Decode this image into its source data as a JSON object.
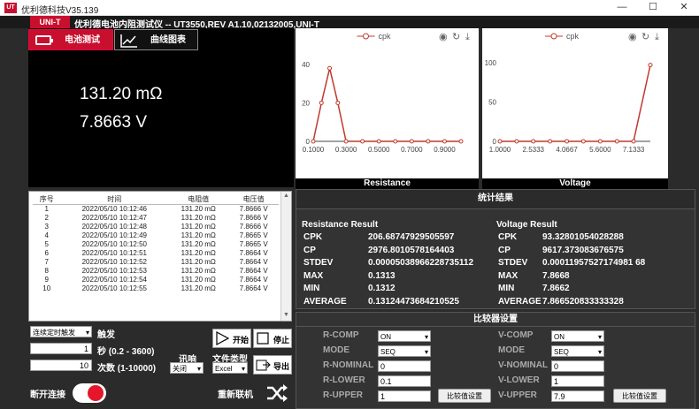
{
  "window": {
    "title": "优利德科技V35.139",
    "min": "—",
    "max": "☐",
    "close": "✕"
  },
  "header": {
    "logo": "UNI-T",
    "subtitle": "优利德电池内阻测试仪 -- UT3550,REV A1.10,02132005,UNI-T"
  },
  "tabs": [
    {
      "label": "电池测试"
    },
    {
      "label": "曲线图表"
    }
  ],
  "reading": {
    "resistance": "131.20 mΩ",
    "voltage": "7.8663 V"
  },
  "table": {
    "headers": [
      "序号",
      "时间",
      "电阻值",
      "电压值"
    ],
    "rows": [
      [
        "1",
        "2022/05/10 10:12:46",
        "131.20 mΩ",
        "7.8666 V"
      ],
      [
        "2",
        "2022/05/10 10:12:47",
        "131.20 mΩ",
        "7.8666 V"
      ],
      [
        "3",
        "2022/05/10 10:12:48",
        "131.20 mΩ",
        "7.8666 V"
      ],
      [
        "4",
        "2022/05/10 10:12:49",
        "131.20 mΩ",
        "7.8665 V"
      ],
      [
        "5",
        "2022/05/10 10:12:50",
        "131.20 mΩ",
        "7.8665 V"
      ],
      [
        "6",
        "2022/05/10 10:12:51",
        "131.20 mΩ",
        "7.8664 V"
      ],
      [
        "7",
        "2022/05/10 10:12:52",
        "131.20 mΩ",
        "7.8664 V"
      ],
      [
        "8",
        "2022/05/10 10:12:53",
        "131.20 mΩ",
        "7.8664 V"
      ],
      [
        "9",
        "2022/05/10 10:12:54",
        "131.20 mΩ",
        "7.8664 V"
      ],
      [
        "10",
        "2022/05/10 10:12:55",
        "131.20 mΩ",
        "7.8664 V"
      ]
    ]
  },
  "controls": {
    "mode_select": "连续定时触发",
    "trigger_label": "触发",
    "interval_value": "1",
    "interval_label": "秒 (0.2 - 3600)",
    "count_value": "10",
    "count_label": "次数 (1-10000)",
    "beep_label": "讯响",
    "beep_value": "关闭",
    "filetype_label": "文件类型",
    "filetype_value": "Excel",
    "start": "开始",
    "stop": "停止",
    "export": "导出"
  },
  "connection": {
    "disconnect": "断开连接",
    "reconnect": "重新联机"
  },
  "charts": [
    {
      "legend": "cpk",
      "caption": "Resistance",
      "yticks": [
        "0",
        "20",
        "40"
      ],
      "xticks": [
        "0.1000",
        "0.3000",
        "0.5000",
        "0.7000",
        "0.9000"
      ]
    },
    {
      "legend": "cpk",
      "caption": "Voltage",
      "yticks": [
        "0",
        "50",
        "100"
      ],
      "xticks": [
        "1.0000",
        "2.5333",
        "4.0667",
        "5.6000",
        "7.1333"
      ]
    }
  ],
  "chart_data": [
    {
      "type": "line",
      "series": [
        {
          "name": "cpk",
          "x": [
            0.1,
            0.15,
            0.2,
            0.25,
            0.3,
            0.4,
            0.5,
            0.6,
            0.7,
            0.8,
            0.9,
            1.0
          ],
          "y": [
            0,
            20,
            38,
            20,
            0,
            0,
            0,
            0,
            0,
            0,
            0,
            0
          ]
        }
      ],
      "ylim": [
        0,
        45
      ],
      "xlim": [
        0.1,
        1.0
      ]
    },
    {
      "type": "line",
      "series": [
        {
          "name": "cpk",
          "x": [
            1,
            1.77,
            2.53,
            3.3,
            4.07,
            4.83,
            5.6,
            6.37,
            7.13,
            7.9
          ],
          "y": [
            0,
            0,
            0,
            0,
            0,
            0,
            0,
            0,
            0,
            97
          ]
        }
      ],
      "ylim": [
        0,
        110
      ],
      "xlim": [
        1,
        7.9
      ]
    }
  ],
  "stats": {
    "title": "统计结果",
    "resistance": {
      "heading": "Resistance Result",
      "rows": [
        [
          "CPK",
          "206.68747929505597"
        ],
        [
          "CP",
          "2976.8010578164403"
        ],
        [
          "STDEV",
          "0.00005038966228735112"
        ],
        [
          "MAX",
          "0.1313"
        ],
        [
          "MIN",
          "0.1312"
        ],
        [
          "AVERAGE",
          "0.13124473684210525"
        ]
      ]
    },
    "voltage": {
      "heading": "Voltage Result",
      "rows": [
        [
          "CPK",
          "93.32801054028288"
        ],
        [
          "CP",
          "9617.373083676575"
        ],
        [
          "STDEV",
          "0.00011957527174981 68"
        ],
        [
          "MAX",
          "7.8668"
        ],
        [
          "MIN",
          "7.8662"
        ],
        [
          "AVERAGE",
          "7.866520833333328"
        ]
      ]
    }
  },
  "compare": {
    "title": "比较器设置",
    "button": "比较值设置",
    "r": {
      "comp_label": "R-COMP",
      "comp": "ON",
      "mode_label": "MODE",
      "mode": "SEQ",
      "nominal_label": "R-NOMINAL",
      "nominal": "0",
      "lower_label": "R-LOWER",
      "lower": "0.1",
      "upper_label": "R-UPPER",
      "upper": "1"
    },
    "v": {
      "comp_label": "V-COMP",
      "comp": "ON",
      "mode_label": "MODE",
      "mode": "SEQ",
      "nominal_label": "V-NOMINAL",
      "nominal": "0",
      "lower_label": "V-LOWER",
      "lower": "1",
      "upper_label": "V-UPPER",
      "upper": "7.9"
    }
  }
}
